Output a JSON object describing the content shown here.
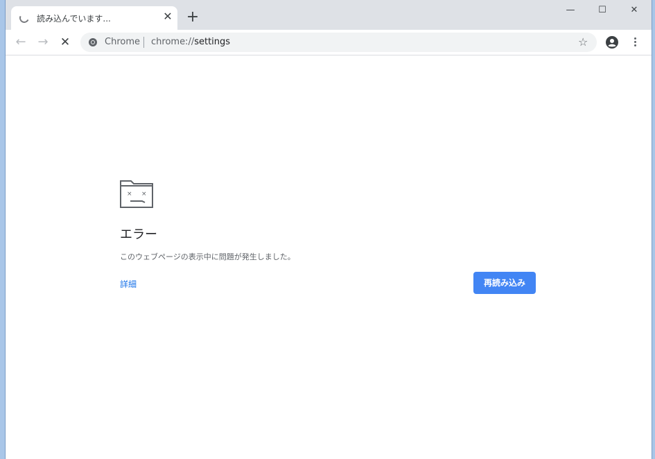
{
  "tab": {
    "title": "読み込んでいます...",
    "close_glyph": "✕"
  },
  "tabstrip": {
    "new_tab_glyph": "+"
  },
  "window_controls": {
    "minimize": "—",
    "maximize": "☐",
    "close": "✕"
  },
  "toolbar": {
    "back_glyph": "←",
    "forward_glyph": "→",
    "stop_glyph": "✕",
    "star_glyph": "☆"
  },
  "omnibox": {
    "site_label": "Chrome",
    "url_scheme": "chrome://",
    "url_path": "settings"
  },
  "error_page": {
    "title": "エラー",
    "description": "このウェブページの表示中に問題が発生しました。",
    "details_link": "詳細",
    "reload_button": "再読み込み"
  },
  "colors": {
    "accent": "#4285f4",
    "link": "#1a73e8",
    "tabstrip_bg": "#dee1e6",
    "omnibox_bg": "#f1f3f4"
  },
  "icons": {
    "tab_loading": "spinner-icon",
    "site": "chrome-icon",
    "profile": "account-circle-icon",
    "menu": "more-vertical-icon",
    "error": "sad-folder-icon"
  }
}
